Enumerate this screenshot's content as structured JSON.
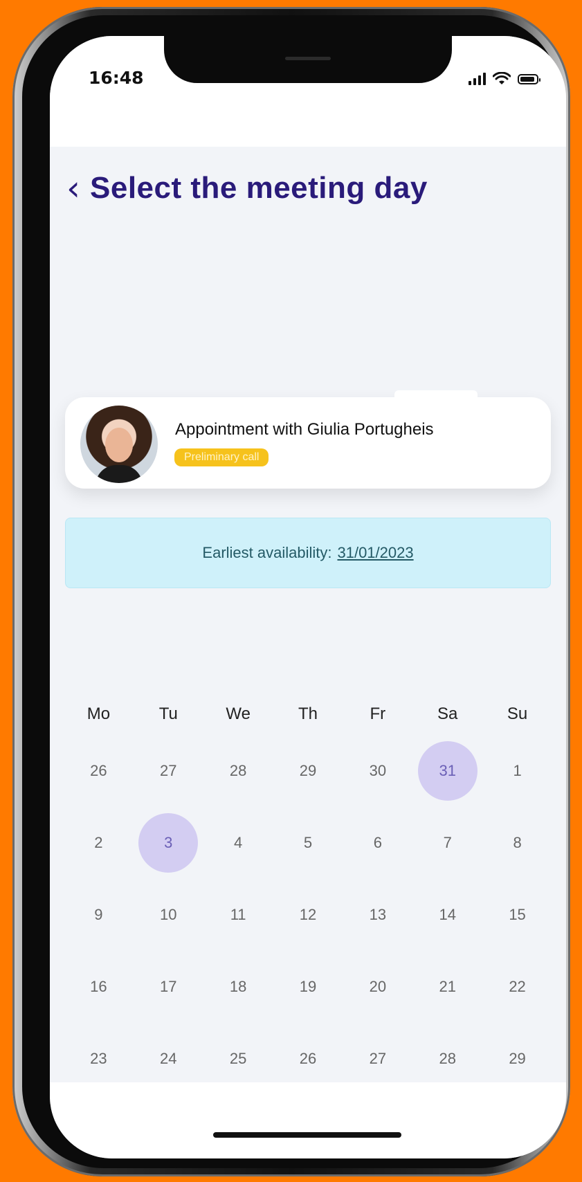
{
  "status_bar": {
    "time": "16:48",
    "icons": [
      "signal-icon",
      "wifi-icon",
      "battery-icon"
    ]
  },
  "header": {
    "back_icon": "chevron-left-icon",
    "title": "Select the meeting day"
  },
  "appointment": {
    "title": "Appointment with Giulia Portugheis",
    "badge": "Preliminary call",
    "badge_color": "#F6C21C"
  },
  "availability": {
    "label": "Earliest availability:",
    "date": "31/01/2023",
    "bg_color": "#CFF1FA"
  },
  "calendar": {
    "weekdays": [
      "Mo",
      "Tu",
      "We",
      "Th",
      "Fr",
      "Sa",
      "Su"
    ],
    "weeks": [
      [
        "26",
        "27",
        "28",
        "29",
        "30",
        "31",
        "1"
      ],
      [
        "2",
        "3",
        "4",
        "5",
        "6",
        "7",
        "8"
      ],
      [
        "9",
        "10",
        "11",
        "12",
        "13",
        "14",
        "15"
      ],
      [
        "16",
        "17",
        "18",
        "19",
        "20",
        "21",
        "22"
      ],
      [
        "23",
        "24",
        "25",
        "26",
        "27",
        "28",
        "29"
      ]
    ],
    "highlighted": [
      {
        "week": 0,
        "day": 5
      },
      {
        "week": 1,
        "day": 1
      }
    ],
    "highlight_color": "#D3CDF2"
  },
  "colors": {
    "page_background": "#FF7A00",
    "title_color": "#2A1B7A"
  }
}
